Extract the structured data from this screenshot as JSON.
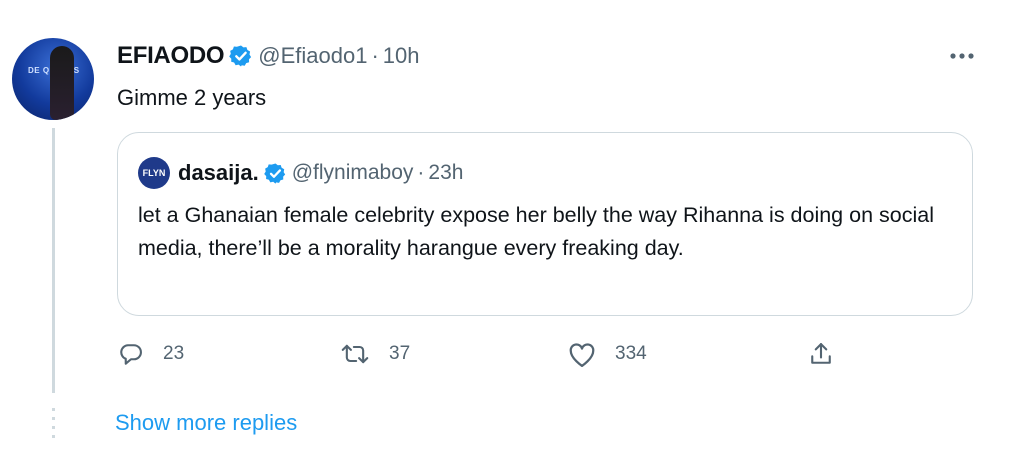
{
  "tweet": {
    "author_name": "EFIAODO",
    "handle": "@Efiaodo1",
    "separator": "·",
    "time": "10h",
    "text": "Gimme 2 years",
    "avatar_text": "DE QUEENS"
  },
  "quote": {
    "avatar_text": "FLYN",
    "author_name": "dasaija.",
    "handle": "@flynimaboy",
    "separator": "·",
    "time": "23h",
    "text": "let a Ghanaian female celebrity expose her belly the way Rihanna is doing on social media, there’ll be a morality harangue every freaking day."
  },
  "actions": {
    "replies": "23",
    "retweets": "37",
    "likes": "334"
  },
  "show_more_replies": "Show more replies",
  "icons": {
    "verified": "verified-badge-icon",
    "more": "more-options-icon",
    "reply": "reply-icon",
    "retweet": "retweet-icon",
    "like": "like-icon",
    "share": "share-icon"
  },
  "colors": {
    "accent": "#1d9bf0",
    "secondary_text": "#536471",
    "border": "#cfd9de"
  }
}
